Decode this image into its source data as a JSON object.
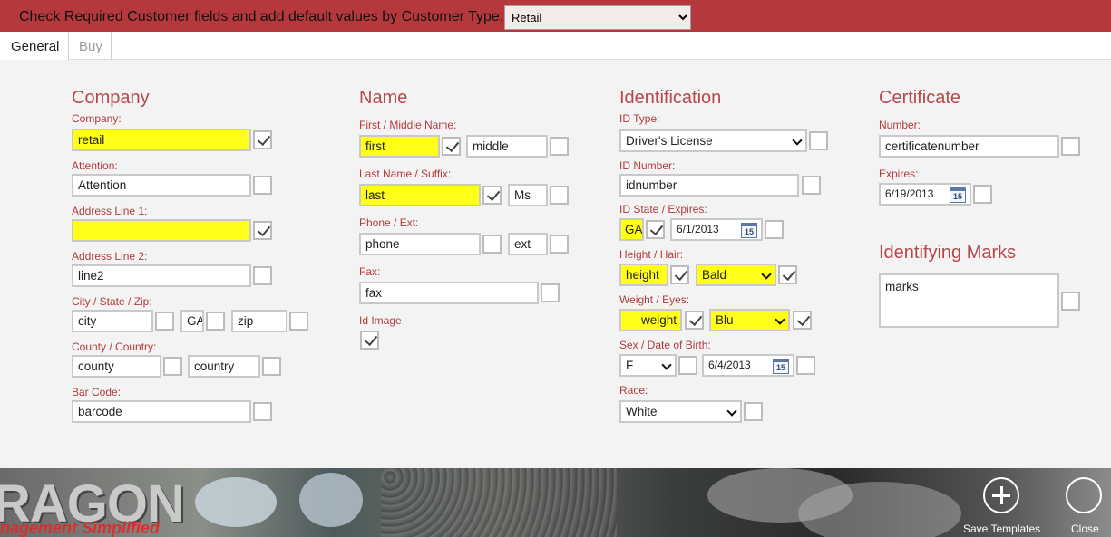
{
  "header": {
    "title": "Check Required Customer fields and add default values by Customer Type:",
    "customer_type": "Retail"
  },
  "tabs": [
    "General",
    "Buy"
  ],
  "company": {
    "heading": "Company",
    "company_label": "Company:",
    "company_value": "retail",
    "attention_label": "Attention:",
    "attention_value": "Attention",
    "address1_label": "Address Line 1:",
    "address1_value": "",
    "address2_label": "Address Line 2:",
    "address2_value": "line2",
    "city_label": "City / State / Zip:",
    "city_value": "city",
    "state_value": "GA",
    "zip_value": "zip",
    "county_label": "County / Country:",
    "county_value": "county",
    "country_value": "country",
    "barcode_label": "Bar Code:",
    "barcode_value": "barcode"
  },
  "name": {
    "heading": "Name",
    "first_label": "First / Middle Name:",
    "first_value": "first",
    "middle_value": "middle",
    "last_label": "Last Name / Suffix:",
    "last_value": "last",
    "suffix_value": "Ms",
    "phone_label": "Phone / Ext:",
    "phone_value": "phone",
    "ext_value": "ext",
    "fax_label": "Fax:",
    "fax_value": "fax",
    "idimage_label": "Id Image"
  },
  "identification": {
    "heading": "Identification",
    "idtype_label": "ID Type:",
    "idtype_value": "Driver's License",
    "idnumber_label": "ID Number:",
    "idnumber_value": "idnumber",
    "idstate_label": "ID State / Expires:",
    "idstate_value": "GA",
    "idexpires_value": "6/1/2013",
    "height_label": "Height / Hair:",
    "height_value": "height",
    "hair_value": "Bald",
    "weight_label": "Weight / Eyes:",
    "weight_value": "weight",
    "eyes_value": "Blu",
    "sex_label": "Sex / Date of Birth:",
    "sex_value": "F",
    "dob_value": "6/4/2013",
    "race_label": "Race:",
    "race_value": "White",
    "calendar_day": "15"
  },
  "certificate": {
    "heading": "Certificate",
    "number_label": "Number:",
    "number_value": "certificatenumber",
    "expires_label": "Expires:",
    "expires_value": "6/19/2013"
  },
  "marks": {
    "heading": "Identifying Marks",
    "value": "marks"
  },
  "banner": {
    "brand_line1": "RAGON",
    "brand_line2": "nagement Simplified"
  },
  "appbar": {
    "save_label": "Save Templates",
    "close_label": "Close"
  }
}
